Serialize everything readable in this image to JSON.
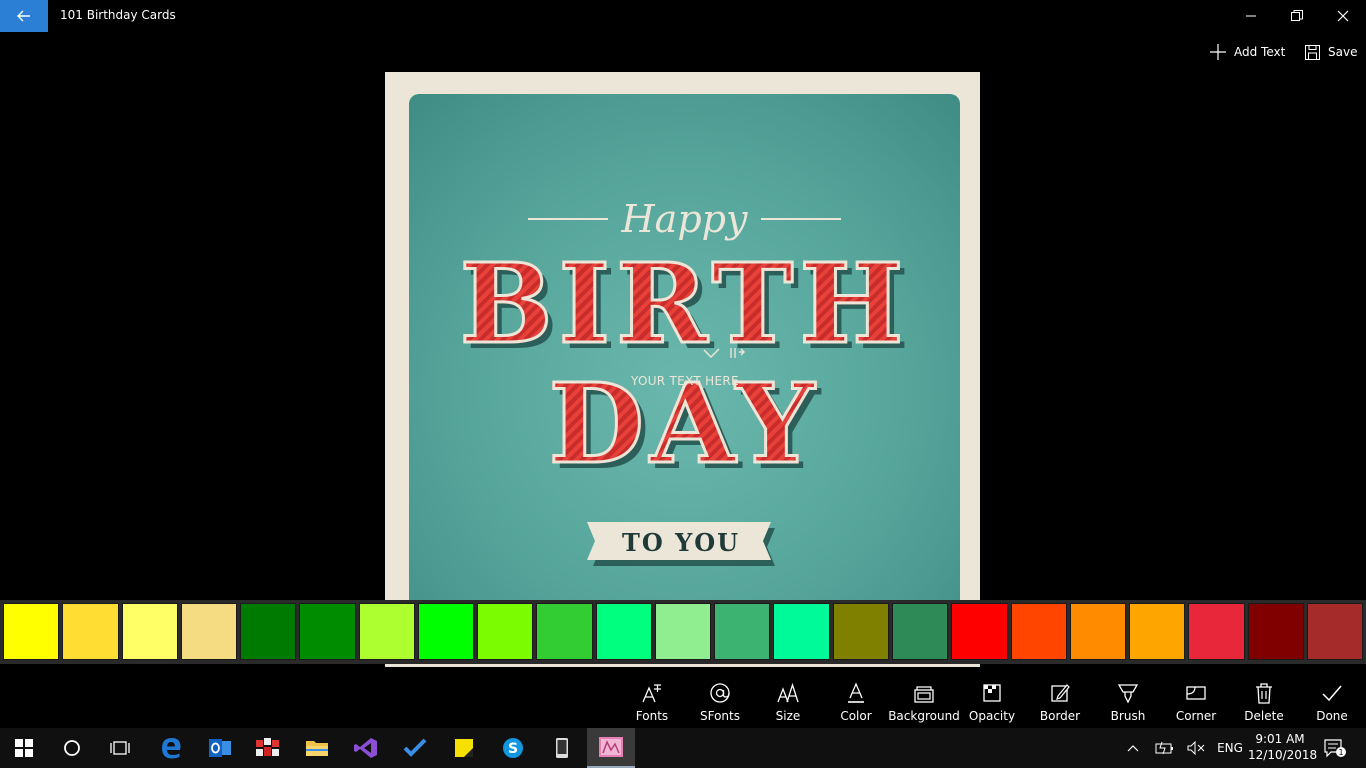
{
  "titlebar": {
    "title": "101 Birthday Cards"
  },
  "commands": {
    "add_text": "Add Text",
    "save": "Save"
  },
  "card": {
    "happy": "Happy",
    "birth": "BIRTH",
    "day": "DAY",
    "to_you": "TO YOU",
    "text_placeholder": "YOUR TEXT HERE"
  },
  "palette": [
    "#ffff00",
    "#ffdd33",
    "#ffff66",
    "#f5dc82",
    "#007a00",
    "#008c00",
    "#adff2f",
    "#00ff00",
    "#7cfc00",
    "#32cd32",
    "#00ff7f",
    "#90ee90",
    "#3cb371",
    "#00fa9a",
    "#808000",
    "#2e8b57",
    "#ff0000",
    "#ff4500",
    "#ff8c00",
    "#ffa500",
    "#e8273b",
    "#800000",
    "#a52a2a"
  ],
  "toolbar": {
    "fonts": "Fonts",
    "sfonts": "SFonts",
    "size": "Size",
    "color": "Color",
    "background": "Background",
    "opacity": "Opacity",
    "border": "Border",
    "brush": "Brush",
    "corner": "Corner",
    "delete": "Delete",
    "done": "Done"
  },
  "taskbar": {
    "language": "ENG",
    "time": "9:01 AM",
    "date": "12/10/2018",
    "notification_count": "1"
  }
}
